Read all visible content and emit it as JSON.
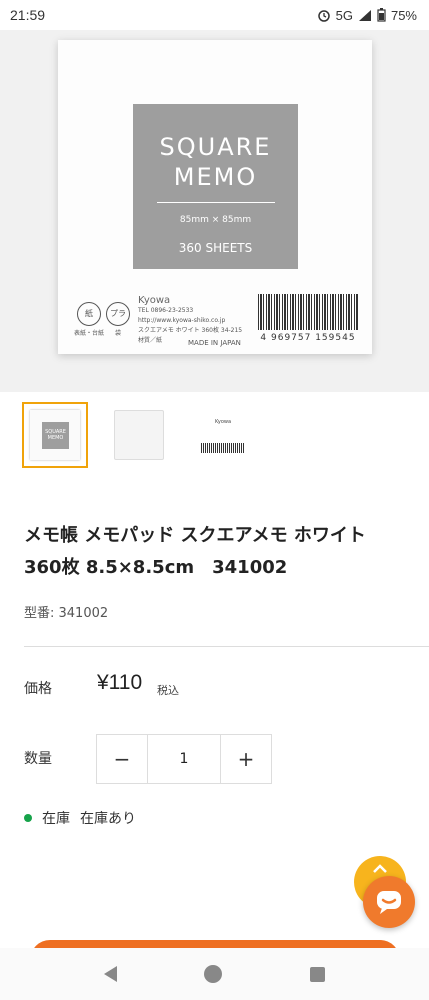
{
  "status_bar": {
    "time": "21:59",
    "network": "5G",
    "battery": "75%"
  },
  "product_image": {
    "label_title": "SQUARE\nMEMO",
    "label_size": "85mm × 85mm",
    "label_sheets": "360 SHEETS",
    "recycle_paper": "紙",
    "recycle_paper_caption": "表紙・台紙",
    "recycle_plastic": "プラ",
    "recycle_plastic_caption": "袋",
    "brand": "Kyowa",
    "tel": "TEL 0896-23-2533",
    "url": "http://www.kyowa-shiko.co.jp",
    "product_line": "スクエアメモ ホワイト 360枚 34-215",
    "material": "材質／紙",
    "made_in": "MADE IN JAPAN",
    "barcode_number": "4 969757 159545"
  },
  "thumbnails": [
    {
      "label": "SQUARE MEMO",
      "selected": true
    },
    {
      "label": "",
      "selected": false
    },
    {
      "label": "Kyowa",
      "selected": false
    }
  ],
  "product": {
    "title": "メモ帳 メモパッド スクエアメモ ホワイト 360枚 8.5×8.5cm　341002",
    "model": "型番: 341002",
    "price_label": "価格",
    "price": "¥110",
    "tax_note": "税込",
    "quantity_label": "数量",
    "quantity": "1",
    "minus": "−",
    "plus": "+",
    "stock_label": "在庫",
    "stock_status": "在庫あり",
    "stock_color": "#16a34a"
  },
  "colors": {
    "accent": "#f07a2c",
    "selected_border": "#f0a30a"
  }
}
